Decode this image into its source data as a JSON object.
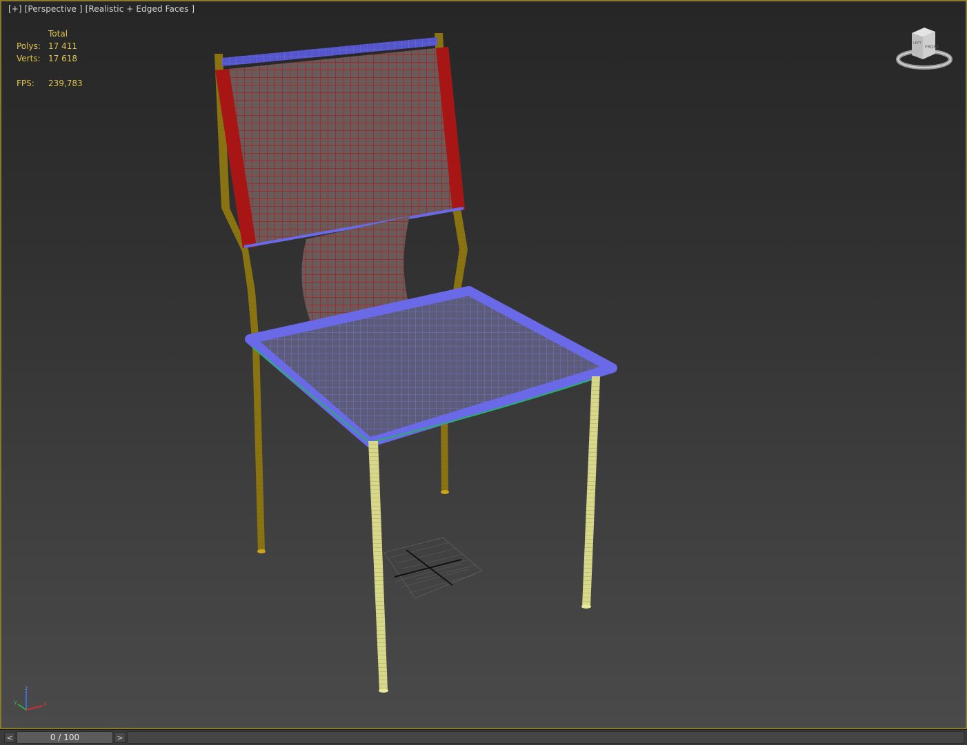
{
  "viewport": {
    "label": "[+] [Perspective ] [Realistic + Edged Faces ]",
    "stats": {
      "header": "Total",
      "polys_label": "Polys:",
      "polys_value": "17 411",
      "verts_label": "Verts:",
      "verts_value": "17 618",
      "fps_label": "FPS:",
      "fps_value": "239,783"
    },
    "viewcube": {
      "front_label": "FRONT",
      "left_label": "LEFT"
    },
    "axis": {
      "x": "x",
      "y": "y",
      "z": "z"
    }
  },
  "colors": {
    "border": "#8a7a2e",
    "backrest": "#b01818",
    "seat": "#6a6ae8",
    "front_legs": "#e8e89a",
    "rear_frame": "#c9a41c",
    "stats_text": "#e0c552"
  },
  "timeline": {
    "prev_label": "<",
    "next_label": ">",
    "frame_text": "0 / 100"
  }
}
